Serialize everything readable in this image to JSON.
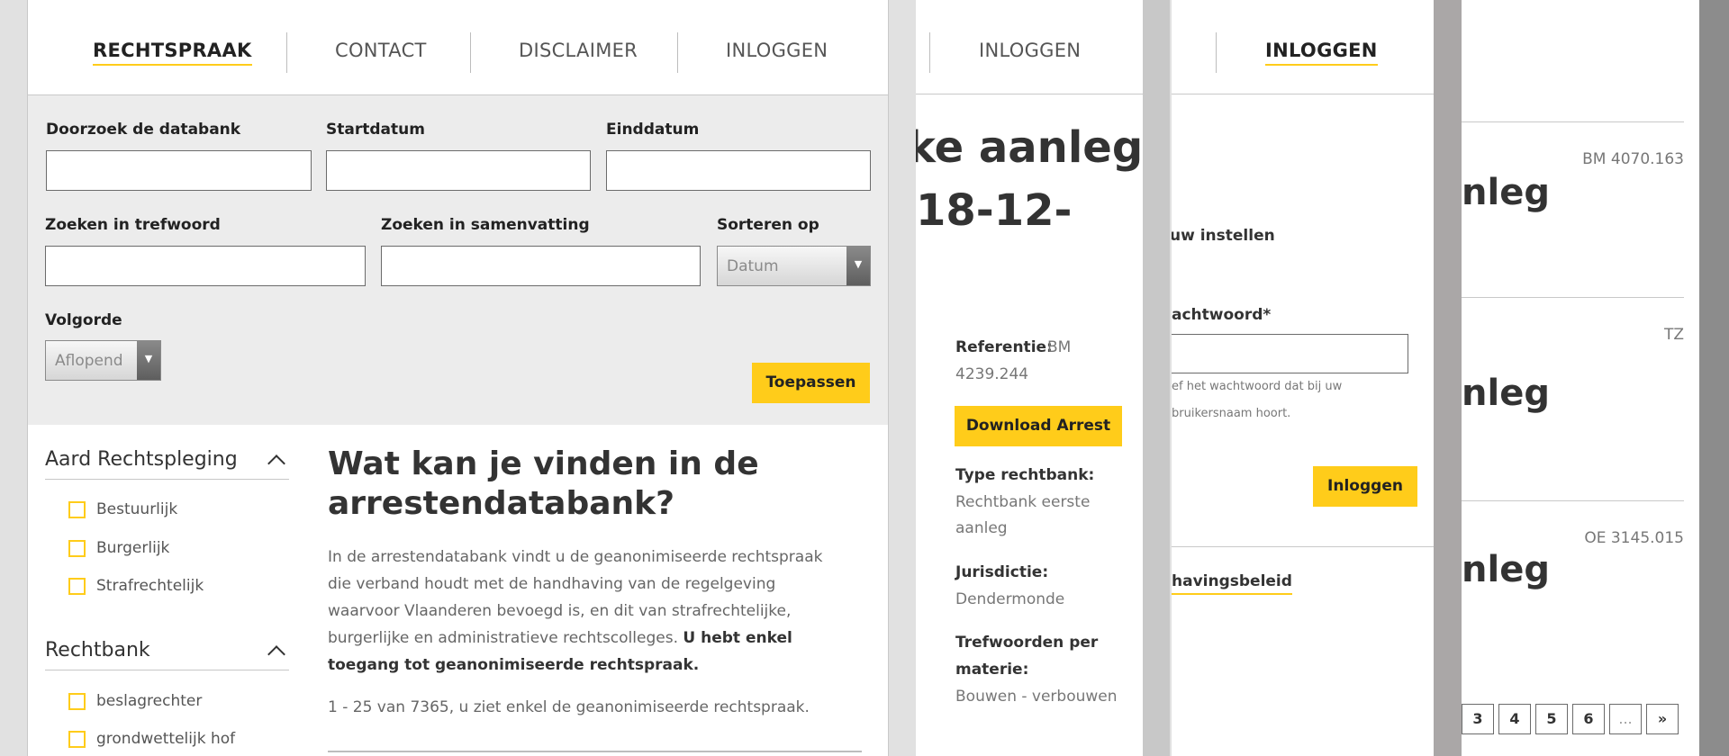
{
  "nav": {
    "items": [
      "RECHTSPRAAK",
      "CONTACT",
      "DISCLAIMER",
      "INLOGGEN"
    ],
    "panel2_item": "INLOGGEN",
    "panel3_item": "INLOGGEN"
  },
  "filters": {
    "search_label": "Doorzoek de databank",
    "start_label": "Startdatum",
    "end_label": "Einddatum",
    "keyword_label": "Zoeken in trefwoord",
    "summary_label": "Zoeken in samenvatting",
    "sort_label": "Sorteren op",
    "sort_value": "Datum",
    "order_label": "Volgorde",
    "order_value": "Aflopend",
    "apply_label": "Toepassen"
  },
  "sidebar": {
    "group1_title": "Aard Rechtspleging",
    "group1_items": [
      "Bestuurlijk",
      "Burgerlijk",
      "Strafrechtelijk"
    ],
    "group2_title": "Rechtbank",
    "group2_items": [
      "beslagrechter",
      "grondwettelijk hof"
    ]
  },
  "main": {
    "heading": "Wat kan je vinden in de arrestendatabank?",
    "para_text": "In de arrestendatabank vindt u de geanonimiseerde rechtspraak die verband houdt met de handhaving van de regelgeving waarvoor Vlaanderen bevoegd is, en dit van strafrechtelijke, burgerlijke en administratieve rechtscolleges. ",
    "para_bold": "U hebt enkel toegang tot geanonimiseerde rechtspraak.",
    "count": "1 - 25 van 7365, u ziet enkel de geanonimiseerde rechtspraak."
  },
  "detail": {
    "title_line1": "ke aanleg",
    "title_line2": "18-12-",
    "ref_label": "Referentie:",
    "ref_value": "BM",
    "ref_value2": "4239.244",
    "download_label": "Download Arrest",
    "court_type_label": "Type rechtbank:",
    "court_type_value1": "Rechtbank eerste",
    "court_type_value2": "aanleg",
    "jurisdiction_label": "Jurisdictie:",
    "jurisdiction_value": "Dendermonde",
    "keywords_label1": "Trefwoorden per",
    "keywords_label2": "materie:",
    "keywords_value": "Bouwen - verbouwen"
  },
  "login": {
    "setting_text": "uw instellen",
    "password_label": "achtwoord*",
    "help_line1": "ef het wachtwoord dat bij uw",
    "help_line2": "bruikersnaam hoort.",
    "login_button": "Inloggen",
    "policy_link": "havingsbeleid"
  },
  "results": {
    "ref1": "BM 4070.163",
    "title1": "nleg",
    "ref2": "TZ",
    "title2": "nleg",
    "ref3": "OE 3145.015",
    "title3": "nleg",
    "pages": [
      "3",
      "4",
      "5",
      "6",
      "...",
      "»"
    ]
  },
  "colors": {
    "accent": "#ffcc1a",
    "filter_bg": "#ececec",
    "page_bg": "#e1e1e1"
  }
}
